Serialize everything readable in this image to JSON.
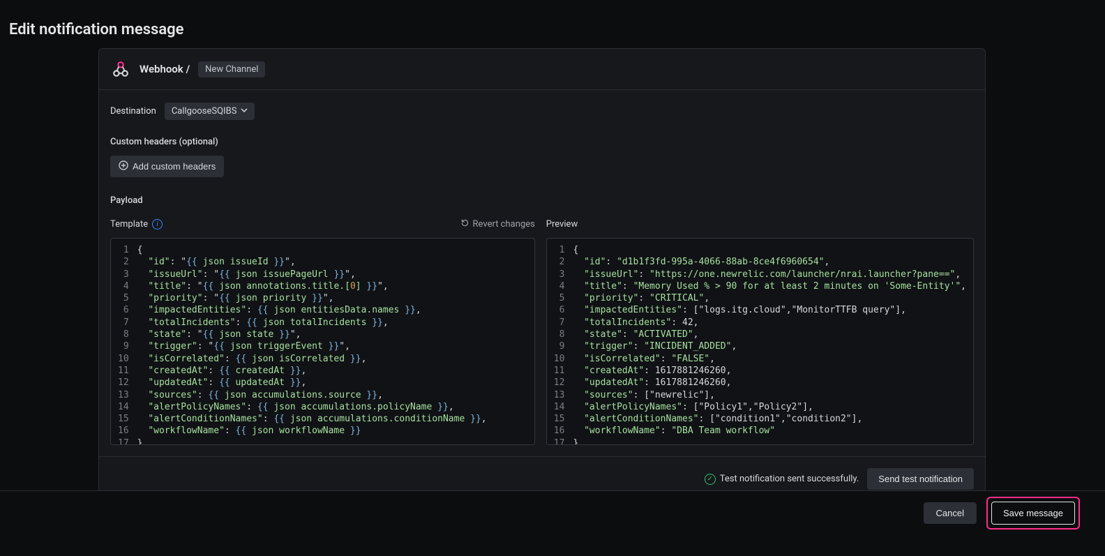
{
  "page_title": "Edit notification message",
  "header": {
    "breadcrumb_label": "Webhook /",
    "channel_name": "New Channel"
  },
  "destination": {
    "label": "Destination",
    "selected": "CallgooseSQIBS"
  },
  "custom_headers": {
    "label": "Custom headers (optional)",
    "add_button": "Add custom headers"
  },
  "payload": {
    "label": "Payload",
    "template_label": "Template",
    "revert_label": "Revert changes",
    "preview_label": "Preview"
  },
  "template_lines": [
    {
      "t": "open"
    },
    {
      "t": "kv",
      "k": "id",
      "e": "json issueId",
      "c": true
    },
    {
      "t": "kv",
      "k": "issueUrl",
      "e": "json issuePageUrl",
      "c": true
    },
    {
      "t": "kv",
      "k": "title",
      "e": "json annotations.title.[0]",
      "c": true,
      "has_idx": true
    },
    {
      "t": "kv",
      "k": "priority",
      "e": "json priority",
      "c": true
    },
    {
      "t": "kvnq",
      "k": "impactedEntities",
      "e": "json entitiesData.names",
      "c": true
    },
    {
      "t": "kvnq",
      "k": "totalIncidents",
      "e": "json totalIncidents",
      "c": true
    },
    {
      "t": "kv",
      "k": "state",
      "e": "json state",
      "c": true
    },
    {
      "t": "kv",
      "k": "trigger",
      "e": "json triggerEvent",
      "c": true
    },
    {
      "t": "kvnq",
      "k": "isCorrelated",
      "e": "json isCorrelated",
      "c": true
    },
    {
      "t": "kvnq",
      "k": "createdAt",
      "e": "createdAt",
      "c": true
    },
    {
      "t": "kvnq",
      "k": "updatedAt",
      "e": "updatedAt",
      "c": true
    },
    {
      "t": "kvnq",
      "k": "sources",
      "e": "json accumulations.source",
      "c": true
    },
    {
      "t": "kvnq",
      "k": "alertPolicyNames",
      "e": "json accumulations.policyName",
      "c": true
    },
    {
      "t": "kvnq",
      "k": "alertConditionNames",
      "e": "json accumulations.conditionName",
      "c": true
    },
    {
      "t": "kvnq",
      "k": "workflowName",
      "e": "json workflowName",
      "c": false
    },
    {
      "t": "close"
    }
  ],
  "preview_lines": [
    {
      "t": "open"
    },
    {
      "t": "str",
      "k": "id",
      "v": "d1b1f3fd-995a-4066-88ab-8ce4f6960654",
      "c": true
    },
    {
      "t": "str",
      "k": "issueUrl",
      "v": "https://one.newrelic.com/launcher/nrai.launcher?pane==",
      "c": true
    },
    {
      "t": "str",
      "k": "title",
      "v": "Memory Used % > 90 for at least 2 minutes on 'Some-Entity'",
      "c": true
    },
    {
      "t": "str",
      "k": "priority",
      "v": "CRITICAL",
      "c": true
    },
    {
      "t": "lit",
      "k": "impactedEntities",
      "v": "[\"logs.itg.cloud\",\"MonitorTTFB query\"]",
      "c": true
    },
    {
      "t": "lit",
      "k": "totalIncidents",
      "v": "42",
      "c": true
    },
    {
      "t": "str",
      "k": "state",
      "v": "ACTIVATED",
      "c": true
    },
    {
      "t": "str",
      "k": "trigger",
      "v": "INCIDENT_ADDED",
      "c": true
    },
    {
      "t": "str",
      "k": "isCorrelated",
      "v": "FALSE",
      "c": true
    },
    {
      "t": "lit",
      "k": "createdAt",
      "v": "1617881246260",
      "c": true
    },
    {
      "t": "lit",
      "k": "updatedAt",
      "v": "1617881246260",
      "c": true
    },
    {
      "t": "lit",
      "k": "sources",
      "v": "[\"newrelic\"]",
      "c": true
    },
    {
      "t": "lit",
      "k": "alertPolicyNames",
      "v": "[\"Policy1\",\"Policy2\"]",
      "c": true
    },
    {
      "t": "lit",
      "k": "alertConditionNames",
      "v": "[\"condition1\",\"condition2\"]",
      "c": true
    },
    {
      "t": "str",
      "k": "workflowName",
      "v": "DBA Team workflow",
      "c": false
    },
    {
      "t": "close"
    }
  ],
  "footer": {
    "status_text": "Test notification sent successfully.",
    "send_test": "Send test notification"
  },
  "bottom": {
    "cancel": "Cancel",
    "save": "Save message"
  }
}
